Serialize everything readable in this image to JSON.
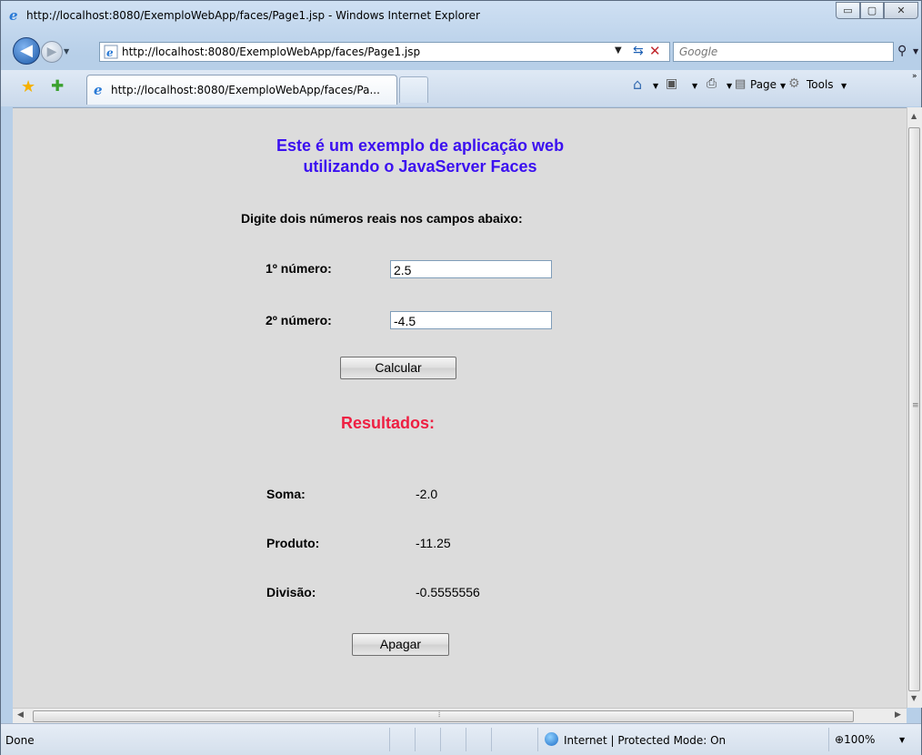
{
  "window": {
    "title": "http://localhost:8080/ExemploWebApp/faces/Page1.jsp - Windows Internet Explorer",
    "min_glyph": "▭",
    "max_glyph": "▢",
    "close_glyph": "✕"
  },
  "address_bar": {
    "url": "http://localhost:8080/ExemploWebApp/faces/Page1.jsp"
  },
  "search": {
    "placeholder": "Google"
  },
  "tab": {
    "label": "http://localhost:8080/ExemploWebApp/faces/Pa..."
  },
  "command_bar": {
    "page_label": "Page",
    "tools_label": "Tools"
  },
  "page": {
    "heading_line1": "Este é um exemplo de aplicação web",
    "heading_line2": "utilizando o JavaServer Faces",
    "instruction": "Digite dois números reais nos campos abaixo:",
    "field1_label": "1º número:",
    "field1_value": "2.5",
    "field2_label": "2º número:",
    "field2_value": "-4.5",
    "calculate_label": "Calcular",
    "results_title": "Resultados:",
    "results": [
      {
        "label": "Soma:",
        "value": "-2.0"
      },
      {
        "label": "Produto:",
        "value": "-11.25"
      },
      {
        "label": "Divisão:",
        "value": "-0.5555556"
      }
    ],
    "clear_label": "Apagar"
  },
  "status_bar": {
    "status": "Done",
    "zone": "Internet | Protected Mode: On",
    "zoom": "100%"
  },
  "colors": {
    "heading": "#3b10f0",
    "results_title": "#ee1f42",
    "page_background": "#dcdcdc"
  },
  "icons": [
    "ie-logo-icon",
    "back-arrow-icon",
    "forward-arrow-icon",
    "refresh-icon",
    "stop-icon",
    "search-icon",
    "favorites-star-icon",
    "add-favorite-icon",
    "home-icon",
    "feeds-icon",
    "print-icon",
    "page-icon",
    "tools-gear-icon",
    "globe-icon",
    "zoom-icon"
  ]
}
